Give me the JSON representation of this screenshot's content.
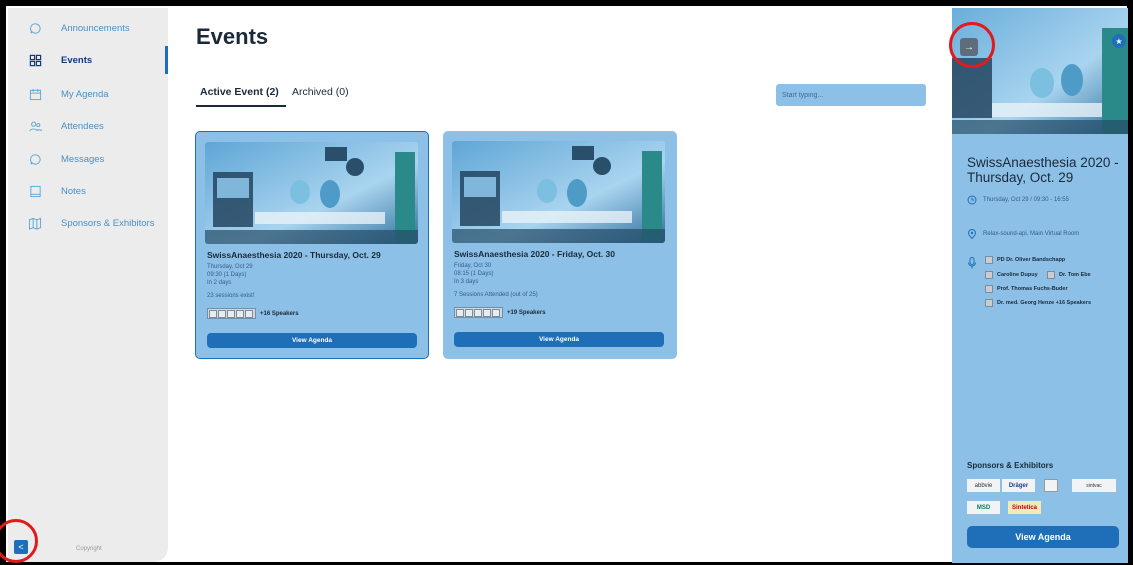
{
  "sidebar": {
    "items": [
      {
        "label": "Announcements",
        "icon": "chat-bubble-icon"
      },
      {
        "label": "Events",
        "icon": "grid-icon",
        "active": true
      },
      {
        "label": "My Agenda",
        "icon": "calendar-icon"
      },
      {
        "label": "Attendees",
        "icon": "people-icon"
      },
      {
        "label": "Messages",
        "icon": "chat-bubble-icon"
      },
      {
        "label": "Notes",
        "icon": "notebook-icon"
      },
      {
        "label": "Sponsors & Exhibitors",
        "icon": "map-icon"
      }
    ],
    "copyright": "Copyright",
    "collapse_glyph": "<"
  },
  "main": {
    "title": "Events",
    "tabs": [
      {
        "label": "Active Event (2)",
        "active": true
      },
      {
        "label": "Archived (0)",
        "active": false
      }
    ],
    "search_placeholder": "Start typing..."
  },
  "cards": [
    {
      "title": "SwissAnaesthesia 2020 - Thursday, Oct. 29",
      "date": "Thursday, Oct 29",
      "time": "09:30 (1 Days)",
      "relative": "In 2 days",
      "sessions": "23 sessions exist!",
      "speakers": "+16 Speakers",
      "button": "View Agenda",
      "selected": true
    },
    {
      "title": "SwissAnaesthesia 2020 - Friday, Oct. 30",
      "date": "Friday, Oct 30",
      "time": "08:15 (1 Days)",
      "relative": "In 3 days",
      "sessions": "7 Sessions Attended (out of 25)",
      "speakers": "+19 Speakers",
      "button": "View Agenda",
      "selected": false
    }
  ],
  "detail": {
    "title": "SwissAnaesthesia 2020 - Thursday, Oct. 29",
    "datetime": "Thursday, Oct 29 / 09:30 - 16:55",
    "location": "Relax-sound-api, Main Virtual Room",
    "speakers": [
      "PD Dr. Oliver Bandschapp",
      "Caroline Dupuy",
      "Dr. Tom Ebe",
      "Prof. Thomas Fuchs-Buder",
      "Dr. med. Georg Henze"
    ],
    "more_speakers": "+16 Speakers",
    "sponsors_title": "Sponsors & Exhibitors",
    "sponsors": [
      "abbvie",
      "Dräger",
      "",
      "sintvac",
      "MSD",
      "Sintetica"
    ],
    "button": "View Agenda",
    "arrow_glyph": "→",
    "star_glyph": "★"
  },
  "colors": {
    "accent": "#1e6fb8",
    "panel": "#8cc0e6",
    "sidebar": "#ececec",
    "highlight": "#e01b1b"
  }
}
